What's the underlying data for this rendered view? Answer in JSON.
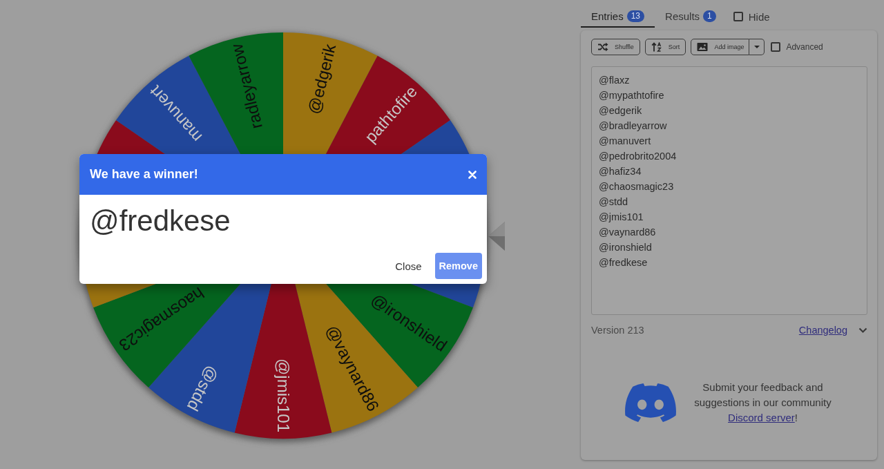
{
  "wheel": {
    "segments": [
      {
        "color": "#9b7310",
        "label": "@edgerik"
      },
      {
        "color": "#8a0b1c",
        "label": "pathtofire"
      },
      {
        "color": "#21469a"
      },
      {
        "color": "#21469a"
      },
      {
        "color": "#05651f",
        "label": "@ironshield"
      },
      {
        "color": "#9b7310",
        "label": "@vaynard86"
      },
      {
        "color": "#8a0b1c",
        "label": "@jmis101"
      },
      {
        "color": "#21469a",
        "label": "@stdd"
      },
      {
        "color": "#05651f",
        "label": "haosmagic23"
      },
      {
        "color": "#9b7310"
      },
      {
        "color": "#8a0b1c"
      },
      {
        "color": "#21469a",
        "label": "manuvert"
      },
      {
        "color": "#05651f",
        "label": "radleyarrow"
      }
    ]
  },
  "winner_dialog": {
    "title": "We have a winner!",
    "winner": "@fredkese",
    "buttons": [
      {
        "label": "Close",
        "kind": "text"
      },
      {
        "label": "Remove",
        "kind": "primary"
      }
    ]
  },
  "tabs": [
    {
      "label": "Entries",
      "count": "13",
      "selected": true
    },
    {
      "label": "Results",
      "count": "1",
      "selected": false
    }
  ],
  "hide": {
    "label": "Hide",
    "checked": false
  },
  "toolbar": {
    "buttons": [
      {
        "label": "Shuffle",
        "kind": "shuffle",
        "dropdown": false
      },
      {
        "label": "Sort",
        "kind": "sort",
        "dropdown": false
      },
      {
        "label": "Add image",
        "kind": "image",
        "dropdown": true
      }
    ],
    "advanced": {
      "label": "Advanced",
      "checked": false
    }
  },
  "entries": [
    "@flaxz",
    "@mypathtofire",
    "@edgerik",
    "@bradleyarrow",
    "@manuvert",
    "@pedrobrito2004",
    "@hafiz34",
    "@chaosmagic23",
    "@stdd",
    "@jmis101",
    "@vaynard86",
    "@ironshield",
    "@fredkese"
  ],
  "version_bar": {
    "version": "Version 213",
    "link": "Changelog"
  },
  "feedback": {
    "text": "Submit your feedback and suggestions in our community",
    "link": "Discord server",
    "suffix": "!"
  }
}
